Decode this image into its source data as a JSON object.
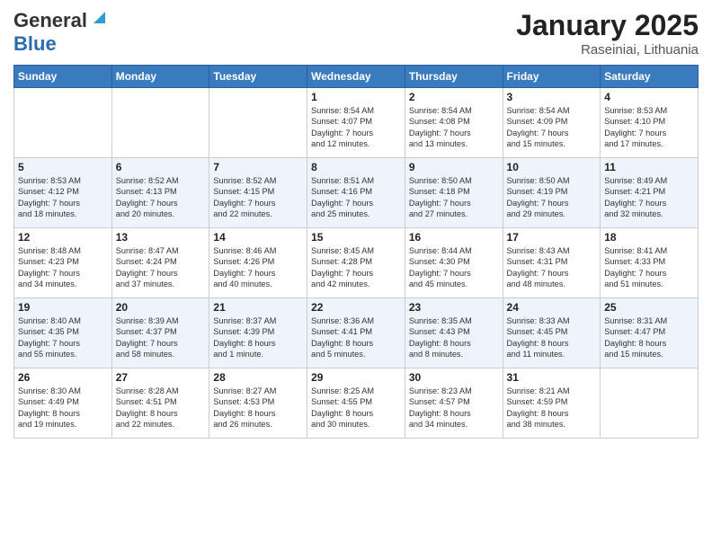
{
  "header": {
    "logo_general": "General",
    "logo_blue": "Blue",
    "month": "January 2025",
    "location": "Raseiniai, Lithuania"
  },
  "days_of_week": [
    "Sunday",
    "Monday",
    "Tuesday",
    "Wednesday",
    "Thursday",
    "Friday",
    "Saturday"
  ],
  "weeks": [
    [
      {
        "day": "",
        "info": ""
      },
      {
        "day": "",
        "info": ""
      },
      {
        "day": "",
        "info": ""
      },
      {
        "day": "1",
        "info": "Sunrise: 8:54 AM\nSunset: 4:07 PM\nDaylight: 7 hours\nand 12 minutes."
      },
      {
        "day": "2",
        "info": "Sunrise: 8:54 AM\nSunset: 4:08 PM\nDaylight: 7 hours\nand 13 minutes."
      },
      {
        "day": "3",
        "info": "Sunrise: 8:54 AM\nSunset: 4:09 PM\nDaylight: 7 hours\nand 15 minutes."
      },
      {
        "day": "4",
        "info": "Sunrise: 8:53 AM\nSunset: 4:10 PM\nDaylight: 7 hours\nand 17 minutes."
      }
    ],
    [
      {
        "day": "5",
        "info": "Sunrise: 8:53 AM\nSunset: 4:12 PM\nDaylight: 7 hours\nand 18 minutes."
      },
      {
        "day": "6",
        "info": "Sunrise: 8:52 AM\nSunset: 4:13 PM\nDaylight: 7 hours\nand 20 minutes."
      },
      {
        "day": "7",
        "info": "Sunrise: 8:52 AM\nSunset: 4:15 PM\nDaylight: 7 hours\nand 22 minutes."
      },
      {
        "day": "8",
        "info": "Sunrise: 8:51 AM\nSunset: 4:16 PM\nDaylight: 7 hours\nand 25 minutes."
      },
      {
        "day": "9",
        "info": "Sunrise: 8:50 AM\nSunset: 4:18 PM\nDaylight: 7 hours\nand 27 minutes."
      },
      {
        "day": "10",
        "info": "Sunrise: 8:50 AM\nSunset: 4:19 PM\nDaylight: 7 hours\nand 29 minutes."
      },
      {
        "day": "11",
        "info": "Sunrise: 8:49 AM\nSunset: 4:21 PM\nDaylight: 7 hours\nand 32 minutes."
      }
    ],
    [
      {
        "day": "12",
        "info": "Sunrise: 8:48 AM\nSunset: 4:23 PM\nDaylight: 7 hours\nand 34 minutes."
      },
      {
        "day": "13",
        "info": "Sunrise: 8:47 AM\nSunset: 4:24 PM\nDaylight: 7 hours\nand 37 minutes."
      },
      {
        "day": "14",
        "info": "Sunrise: 8:46 AM\nSunset: 4:26 PM\nDaylight: 7 hours\nand 40 minutes."
      },
      {
        "day": "15",
        "info": "Sunrise: 8:45 AM\nSunset: 4:28 PM\nDaylight: 7 hours\nand 42 minutes."
      },
      {
        "day": "16",
        "info": "Sunrise: 8:44 AM\nSunset: 4:30 PM\nDaylight: 7 hours\nand 45 minutes."
      },
      {
        "day": "17",
        "info": "Sunrise: 8:43 AM\nSunset: 4:31 PM\nDaylight: 7 hours\nand 48 minutes."
      },
      {
        "day": "18",
        "info": "Sunrise: 8:41 AM\nSunset: 4:33 PM\nDaylight: 7 hours\nand 51 minutes."
      }
    ],
    [
      {
        "day": "19",
        "info": "Sunrise: 8:40 AM\nSunset: 4:35 PM\nDaylight: 7 hours\nand 55 minutes."
      },
      {
        "day": "20",
        "info": "Sunrise: 8:39 AM\nSunset: 4:37 PM\nDaylight: 7 hours\nand 58 minutes."
      },
      {
        "day": "21",
        "info": "Sunrise: 8:37 AM\nSunset: 4:39 PM\nDaylight: 8 hours\nand 1 minute."
      },
      {
        "day": "22",
        "info": "Sunrise: 8:36 AM\nSunset: 4:41 PM\nDaylight: 8 hours\nand 5 minutes."
      },
      {
        "day": "23",
        "info": "Sunrise: 8:35 AM\nSunset: 4:43 PM\nDaylight: 8 hours\nand 8 minutes."
      },
      {
        "day": "24",
        "info": "Sunrise: 8:33 AM\nSunset: 4:45 PM\nDaylight: 8 hours\nand 11 minutes."
      },
      {
        "day": "25",
        "info": "Sunrise: 8:31 AM\nSunset: 4:47 PM\nDaylight: 8 hours\nand 15 minutes."
      }
    ],
    [
      {
        "day": "26",
        "info": "Sunrise: 8:30 AM\nSunset: 4:49 PM\nDaylight: 8 hours\nand 19 minutes."
      },
      {
        "day": "27",
        "info": "Sunrise: 8:28 AM\nSunset: 4:51 PM\nDaylight: 8 hours\nand 22 minutes."
      },
      {
        "day": "28",
        "info": "Sunrise: 8:27 AM\nSunset: 4:53 PM\nDaylight: 8 hours\nand 26 minutes."
      },
      {
        "day": "29",
        "info": "Sunrise: 8:25 AM\nSunset: 4:55 PM\nDaylight: 8 hours\nand 30 minutes."
      },
      {
        "day": "30",
        "info": "Sunrise: 8:23 AM\nSunset: 4:57 PM\nDaylight: 8 hours\nand 34 minutes."
      },
      {
        "day": "31",
        "info": "Sunrise: 8:21 AM\nSunset: 4:59 PM\nDaylight: 8 hours\nand 38 minutes."
      },
      {
        "day": "",
        "info": ""
      }
    ]
  ]
}
